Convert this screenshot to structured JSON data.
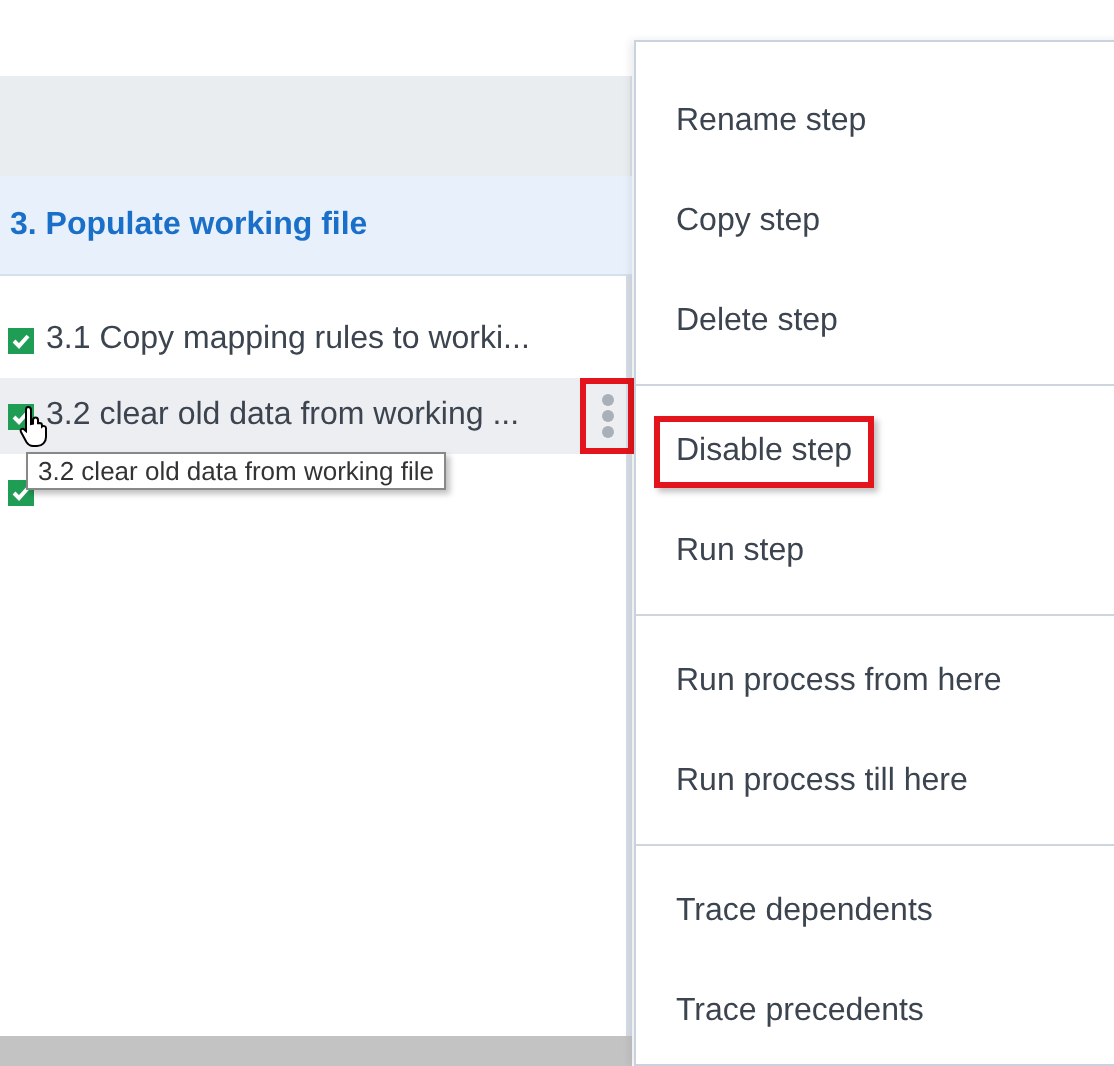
{
  "section": {
    "title": "3. Populate working file"
  },
  "steps": [
    {
      "label": "3.1 Copy mapping rules to worki...",
      "checked": true,
      "selected": false
    },
    {
      "label": "3.2 clear old data from working ...",
      "checked": true,
      "selected": true
    },
    {
      "checked": true,
      "selected": false
    }
  ],
  "step_menu_button": {
    "highlighted": true
  },
  "tooltip": {
    "text": "3.2 clear old data from working file"
  },
  "context_menu": {
    "groups": [
      [
        {
          "label": "Rename step",
          "highlighted": false
        },
        {
          "label": "Copy step",
          "highlighted": false
        },
        {
          "label": "Delete step",
          "highlighted": false
        }
      ],
      [
        {
          "label": "Disable step",
          "highlighted": true
        },
        {
          "label": "Run step",
          "highlighted": false
        }
      ],
      [
        {
          "label": "Run process from here",
          "highlighted": false
        },
        {
          "label": "Run process till here",
          "highlighted": false
        }
      ],
      [
        {
          "label": "Trace dependents",
          "highlighted": false
        },
        {
          "label": "Trace precedents",
          "highlighted": false
        }
      ]
    ]
  }
}
